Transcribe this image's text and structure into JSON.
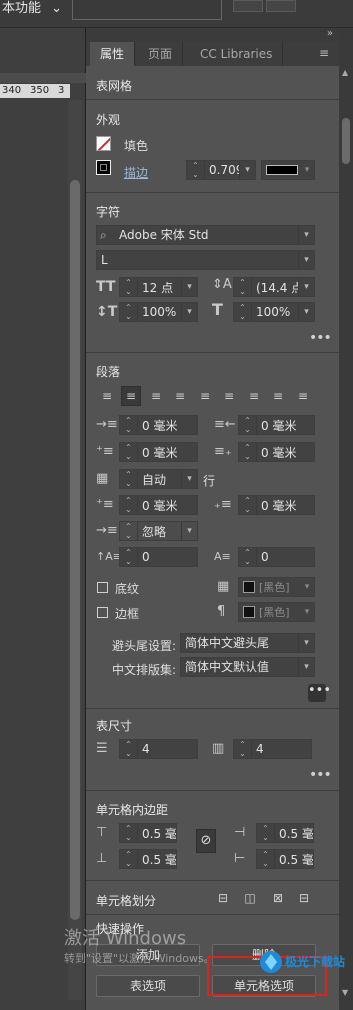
{
  "topbar": {
    "workspace_label": "本功能",
    "workspace_chevron": "⌄"
  },
  "ruler": {
    "ticks": [
      "340",
      "350",
      "3"
    ]
  },
  "panel": {
    "tabs": [
      {
        "label": "属性",
        "active": true
      },
      {
        "label": "页面",
        "active": false
      },
      {
        "label": "CC Libraries",
        "active": false
      }
    ],
    "menu_icon": "panel-menu-icon",
    "section_title": "表网格",
    "appearance": {
      "title": "外观",
      "fill_label": "填色",
      "stroke_label": "描边",
      "stroke_weight": "0.709",
      "stroke_swatch_color": "#000000"
    },
    "character": {
      "title": "字符",
      "font_family": "Adobe 宋体 Std",
      "font_style": "L",
      "font_size": "12 点",
      "leading": "(14.4 点",
      "vertical_scale": "100%",
      "horizontal_scale": "100%"
    },
    "paragraph": {
      "title": "段落",
      "left_indent": "0 毫米",
      "right_indent": "0 毫米",
      "first_line_indent": "0 毫米",
      "last_line_indent": "0 毫米",
      "grid_align": "自动",
      "grid_align_suffix": "行",
      "space_before": "0 毫米",
      "space_after": "0 毫米",
      "ignore_label": "忽略",
      "drop_cap_lines": "0",
      "drop_cap_chars": "0",
      "shading_label": "底纹",
      "shading_color": "[黑色]",
      "border_label": "边框",
      "border_color": "[黑色]",
      "kinsoku_label": "避头尾设置:",
      "kinsoku_value": "简体中文避头尾",
      "mojikumi_label": "中文排版集:",
      "mojikumi_value": "简体中文默认值"
    },
    "table_dims": {
      "title": "表尺寸",
      "rows": "4",
      "columns": "4"
    },
    "cell_inset": {
      "title": "单元格内边距",
      "top": "0.5 毫",
      "bottom": "0.5 毫",
      "left": "0.5 毫",
      "right": "0.5 毫"
    },
    "cell_split": {
      "title": "单元格划分"
    },
    "quick_actions": {
      "title": "快速操作",
      "add_label": "添加",
      "delete_label": "删除",
      "table_options_label": "表选项",
      "cell_options_label": "单元格选项"
    }
  },
  "overlay": {
    "watermark_line1": "激活 Windows",
    "watermark_line2": "转到\"设置\"以激活 Windows。",
    "logo_text": "极光下载站",
    "highlight_color": "#e0221a"
  }
}
